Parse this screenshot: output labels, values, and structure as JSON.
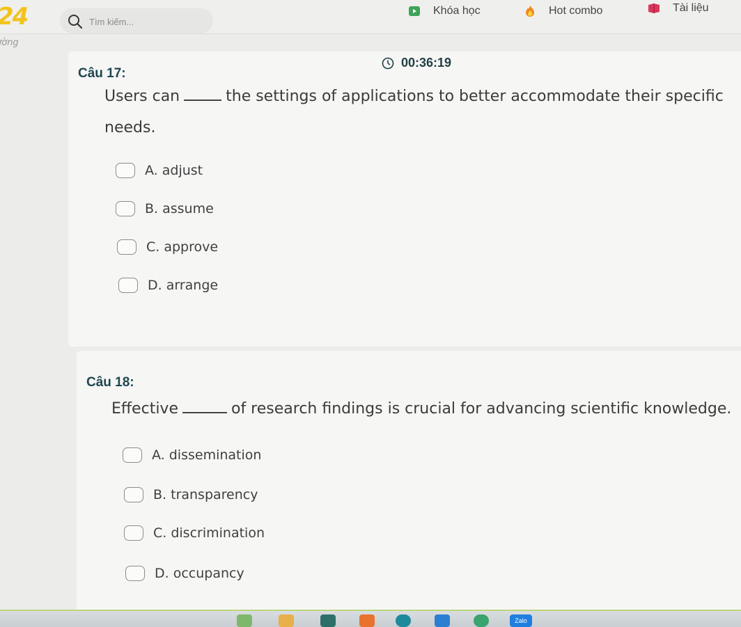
{
  "header": {
    "logo": "24",
    "search_placeholder": "Tìm kiếm...",
    "nav": [
      {
        "label": "Khóa học",
        "icon": "play-icon"
      },
      {
        "label": "Hot combo",
        "icon": "fire-icon"
      },
      {
        "label": "Tài liệu",
        "icon": "book-icon"
      }
    ],
    "subbar_text": "ường"
  },
  "timer": "00:36:19",
  "questions": [
    {
      "title": "Câu 17:",
      "text_before": "Users can",
      "text_after": "the settings of applications to better accommodate their specific",
      "text_line2": "needs.",
      "options": [
        "A. adjust",
        "B. assume",
        "C. approve",
        "D. arrange"
      ]
    },
    {
      "title": "Câu 18:",
      "text_before": "Effective",
      "text_after": "of research findings is crucial for advancing scientific knowledge.",
      "options": [
        "A. dissemination",
        "B. transparency",
        "C. discrimination",
        "D. occupancy"
      ]
    }
  ],
  "taskbar": {
    "zalo_label": "Zalo"
  },
  "colors": {
    "accent": "#f2c31b",
    "title": "#1f4750",
    "background": "#ececea"
  }
}
